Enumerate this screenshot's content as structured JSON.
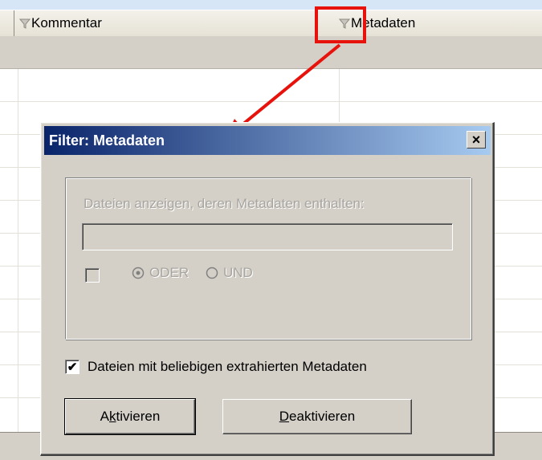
{
  "columns": {
    "comment": "Kommentar",
    "metadata": "Metadaten"
  },
  "dialog": {
    "title": "Filter: Metadaten",
    "close_label": "×",
    "group_label": "Dateien anzeigen, deren Metadaten enthalten:",
    "input_value": "",
    "radio_or": "ODER",
    "radio_and": "UND",
    "radio_selected": "ODER",
    "any_metadata_checkbox_label": "Dateien mit beliebigen extrahierten Metadaten",
    "any_metadata_checked": true,
    "check_mark": "✔",
    "activate_button": {
      "prefix": "A",
      "mnemonic": "k",
      "suffix": "tivieren"
    },
    "deactivate_button": {
      "prefix": "",
      "mnemonic": "D",
      "suffix": "eaktivieren"
    }
  },
  "annotation": {
    "highlight_color": "#e8120c"
  },
  "icons": {
    "column_filter": "funnel-icon",
    "close": "close-icon"
  },
  "colors": {
    "title_gradient_start": "#0a246a",
    "title_gradient_end": "#a6caf0",
    "dialog_face": "#d4d0c8",
    "background": "#d6e6f6"
  }
}
